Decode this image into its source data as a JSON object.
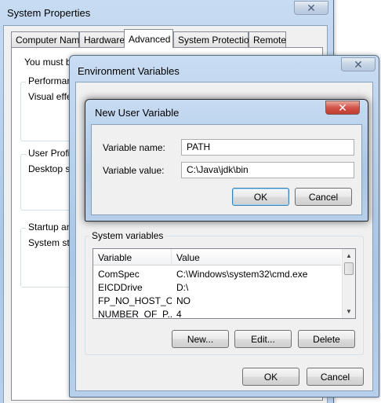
{
  "system_properties": {
    "title": "System Properties",
    "close_glyph": "✕",
    "tabs": [
      {
        "label": "Computer Name"
      },
      {
        "label": "Hardware"
      },
      {
        "label": "Advanced"
      },
      {
        "label": "System Protection"
      },
      {
        "label": "Remote"
      }
    ],
    "partial_texts": {
      "intro": "You must be",
      "performance": "Performanc",
      "visual_effects": "Visual effec",
      "user_profiles": "User Profile",
      "desktop_settings": "Desktop se",
      "startup": "Startup and",
      "system_startup": "System star"
    }
  },
  "environment_variables": {
    "title": "Environment Variables",
    "close_glyph": "✕",
    "system_variables": {
      "heading": "System variables",
      "columns": [
        "Variable",
        "Value"
      ],
      "rows": [
        {
          "variable": "ComSpec",
          "value": "C:\\Windows\\system32\\cmd.exe"
        },
        {
          "variable": "EICDDrive",
          "value": "D:\\"
        },
        {
          "variable": "FP_NO_HOST_C...",
          "value": "NO"
        },
        {
          "variable": "NUMBER_OF_P...",
          "value": "4"
        }
      ],
      "scroll_up_icon": "▲",
      "scroll_down_icon": "▼"
    },
    "buttons": {
      "new": "New...",
      "edit": "Edit...",
      "delete": "Delete",
      "ok": "OK",
      "cancel": "Cancel"
    }
  },
  "new_user_variable": {
    "title": "New User Variable",
    "close_glyph": "✕",
    "name_label": "Variable name:",
    "name_value": "PATH",
    "value_label": "Variable value:",
    "value_value": "C:\\Java\\jdk\\bin",
    "ok": "OK",
    "cancel": "Cancel"
  },
  "colors": {
    "close_active": "#c23b30",
    "frame": "#a9c6e6",
    "client": "#f0f0f0"
  }
}
